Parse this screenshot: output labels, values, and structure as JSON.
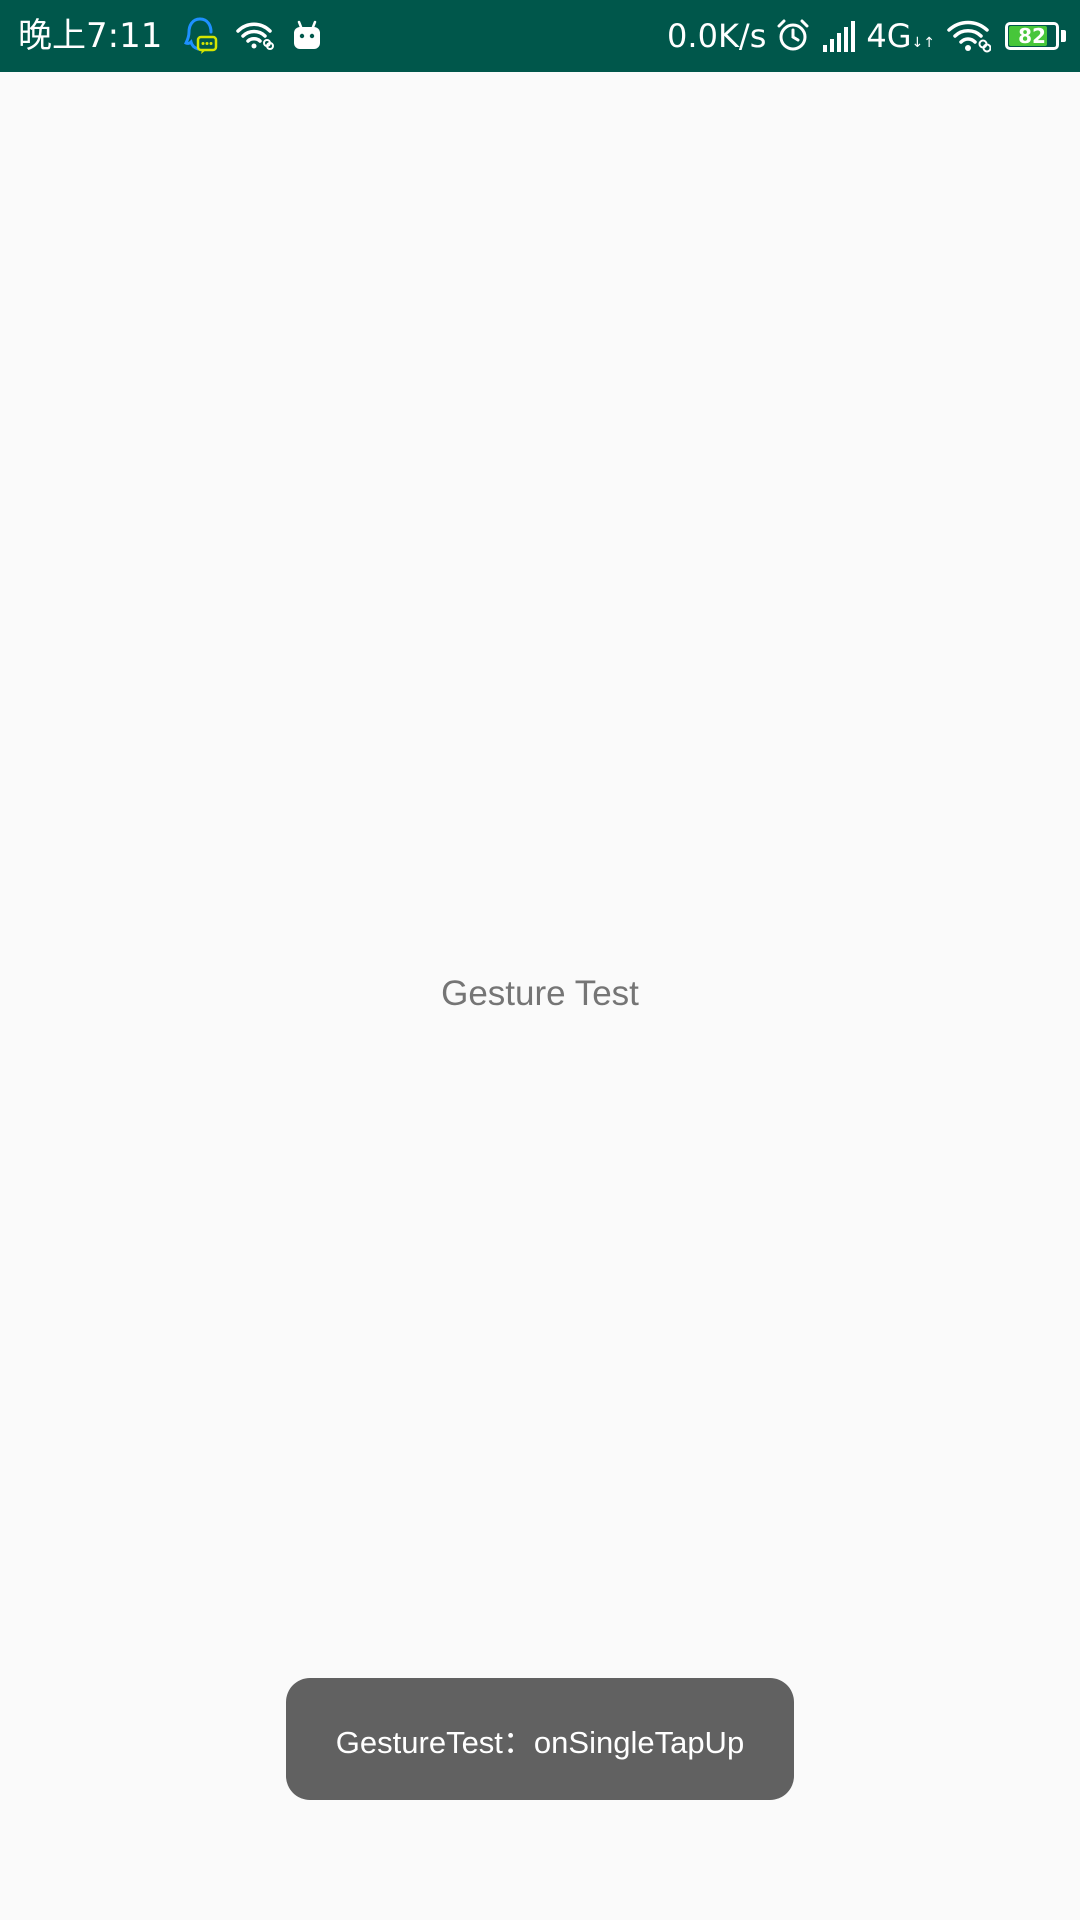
{
  "status_bar": {
    "time": "晚上7:11",
    "net_speed": "0.0K/s",
    "network_type": "4G",
    "network_arrows": "↓↑",
    "battery_level": "82",
    "battery_fraction": 0.82,
    "colors": {
      "background": "#00574b",
      "qq_icon": "#1e90ff",
      "qq_bubble": "#d4e600",
      "battery_fill": "#47c63a"
    },
    "icons": [
      "qq-icon",
      "wifi-link-icon",
      "android-icon",
      "alarm-icon",
      "signal-icon",
      "wifi-link-icon",
      "battery-icon"
    ]
  },
  "main": {
    "label": "Gesture Test"
  },
  "toast": {
    "text": "GestureTest：onSingleTapUp"
  }
}
